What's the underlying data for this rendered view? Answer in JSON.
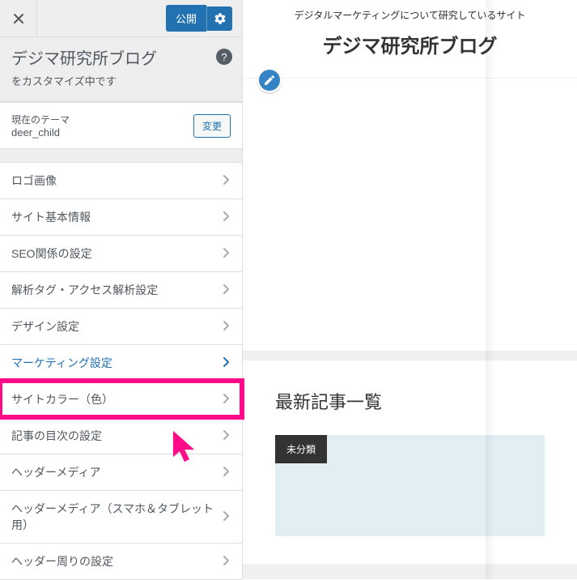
{
  "topbar": {
    "publish_label": "公開"
  },
  "panel": {
    "title": "デジマ研究所ブログ",
    "subtitle": "をカスタマイズ中です",
    "help_glyph": "?"
  },
  "theme": {
    "label": "現在のテーマ",
    "name": "deer_child",
    "change_label": "変更"
  },
  "menu": [
    {
      "label": "ロゴ画像",
      "state": ""
    },
    {
      "label": "サイト基本情報",
      "state": ""
    },
    {
      "label": "SEO関係の設定",
      "state": ""
    },
    {
      "label": "解析タグ・アクセス解析設定",
      "state": ""
    },
    {
      "label": "デザイン設定",
      "state": ""
    },
    {
      "label": "マーケティング設定",
      "state": "active"
    },
    {
      "label": "サイトカラー（色）",
      "state": "hi"
    },
    {
      "label": "記事の目次の設定",
      "state": ""
    },
    {
      "label": "ヘッダーメディア",
      "state": ""
    },
    {
      "label": "ヘッダーメディア（スマホ＆タブレット用）",
      "state": ""
    },
    {
      "label": "ヘッダー周りの設定",
      "state": ""
    }
  ],
  "preview": {
    "tagline": "デジタルマーケティングについて研究しているサイト",
    "site_title": "デジマ研究所ブログ",
    "section_heading": "最新記事一覧",
    "badge": "未分類"
  },
  "colors": {
    "accent": "#2271b1",
    "highlight": "#ff0a89"
  }
}
